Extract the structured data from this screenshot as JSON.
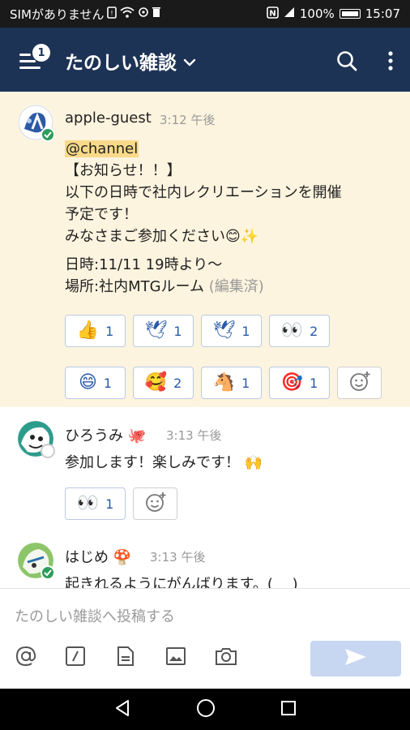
{
  "status_bar": {
    "carrier": "SIMがありません",
    "battery": "100%",
    "time": "15:07"
  },
  "app_bar": {
    "menu_badge": "1",
    "channel_title": "たのしい雑談",
    "icons": [
      "menu-icon",
      "chevron-down-icon",
      "search-icon",
      "more-vert-icon"
    ]
  },
  "messages": [
    {
      "user": "apple-guest",
      "time": "3:12 午後",
      "mention": "@channel",
      "lines": [
        "【お知らせ！！】",
        "以下の日時で社内レクリエーションを開催",
        "予定です！",
        "みなさまご参加ください😊✨"
      ],
      "detail_lines": [
        "日時:11/11 19時より～",
        "場所:社内MTGルーム"
      ],
      "edited": "(編集済)",
      "reactions": [
        {
          "emoji": "👍",
          "count": "1"
        },
        {
          "emoji": "🕊",
          "count": "1"
        },
        {
          "emoji": "🕊",
          "count": "1"
        },
        {
          "emoji": "👀",
          "count": "2"
        },
        {
          "emoji": "😄",
          "count": "1"
        },
        {
          "emoji": "🥰",
          "count": "2"
        },
        {
          "emoji": "🐴",
          "count": "1"
        },
        {
          "emoji": "🎯",
          "count": "1"
        }
      ]
    },
    {
      "user": "ひろうみ",
      "user_emoji": "🐙",
      "time": "3:13 午後",
      "text": "参加します！楽しみです！ 🙌",
      "reactions": [
        {
          "emoji": "👀",
          "count": "1"
        }
      ]
    },
    {
      "user": "はじめ",
      "user_emoji": "🍄",
      "time": "3:13 午後",
      "text": "起きれるようにがんばります。(_ _)"
    }
  ],
  "composer": {
    "placeholder": "たのしい雑談へ投稿する",
    "tools": [
      "at-icon",
      "slash-icon",
      "file-icon",
      "image-icon",
      "camera-icon"
    ]
  },
  "colors": {
    "app_bar": "#1d3355",
    "highlight": "#fdf4df",
    "mention": "#f9d98a",
    "send": "#c7d6f1",
    "presence": "#2e9c5a"
  }
}
